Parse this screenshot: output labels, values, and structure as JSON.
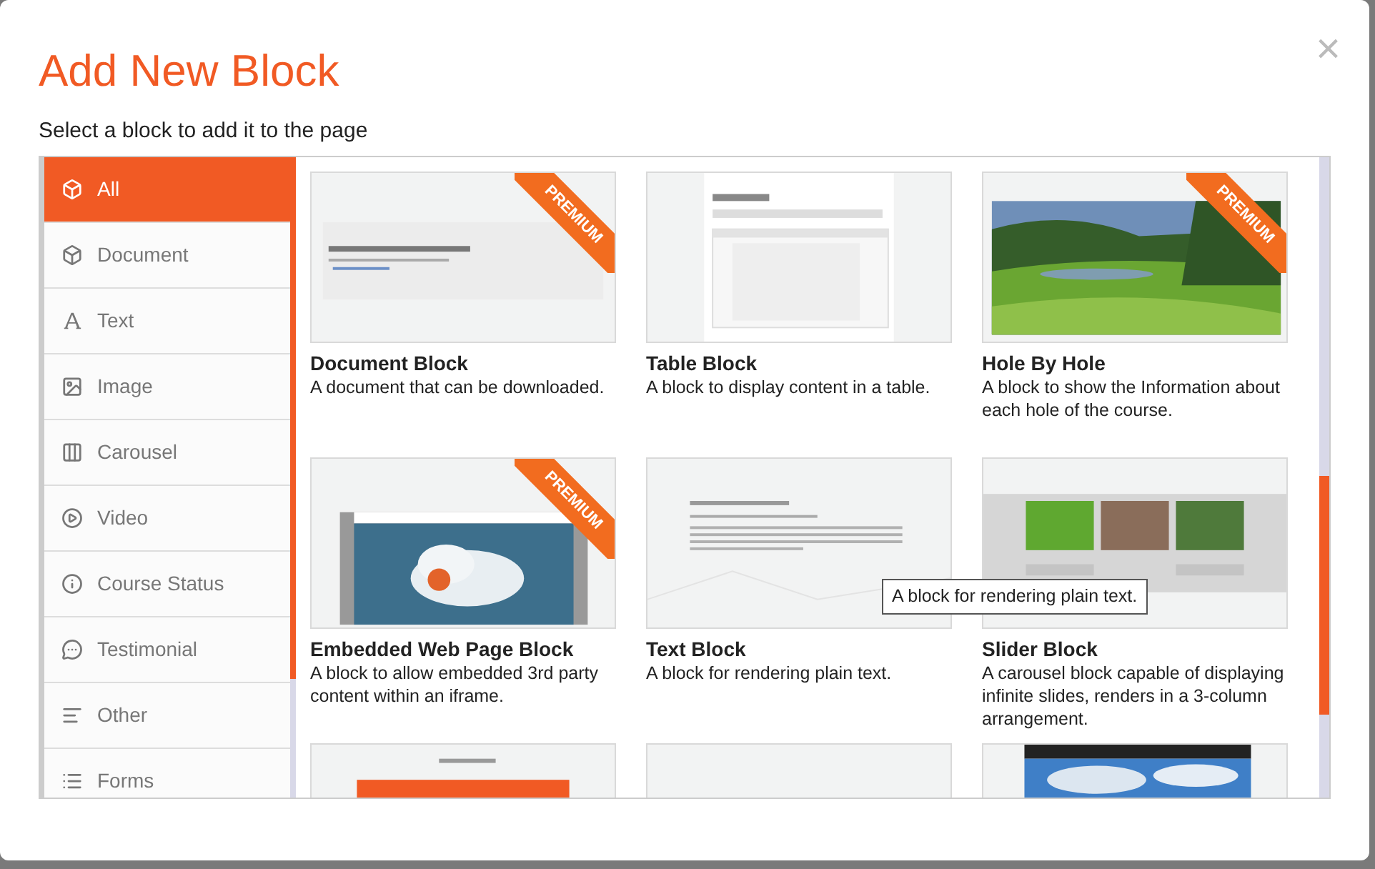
{
  "dialog": {
    "title": "Add New Block",
    "subtitle": "Select a block to add it to the page",
    "close": "×"
  },
  "sidebar": {
    "items": [
      {
        "label": "All",
        "selected": true
      },
      {
        "label": "Document",
        "selected": false
      },
      {
        "label": "Text",
        "selected": false
      },
      {
        "label": "Image",
        "selected": false
      },
      {
        "label": "Carousel",
        "selected": false
      },
      {
        "label": "Video",
        "selected": false
      },
      {
        "label": "Course Status",
        "selected": false
      },
      {
        "label": "Testimonial",
        "selected": false
      },
      {
        "label": "Other",
        "selected": false
      },
      {
        "label": "Forms",
        "selected": false
      }
    ]
  },
  "blocks": [
    {
      "kind": "block",
      "title": "Document Block",
      "description": "A document that can be downloaded.",
      "badge": "PREMIUM"
    },
    {
      "kind": "block",
      "title": "Table Block",
      "description": "A block to display content in a table."
    },
    {
      "kind": "block",
      "title": "Hole By Hole",
      "description": "A block to show the Information about each hole of the course.",
      "badge": "PREMIUM"
    },
    {
      "kind": "block",
      "title": "Embedded Web Page Block",
      "description": "A block to allow embedded 3rd party content within an iframe.",
      "badge": "PREMIUM"
    },
    {
      "kind": "block",
      "title": "Text Block",
      "description": "A block for rendering plain text."
    },
    {
      "kind": "block",
      "title": "Slider Block",
      "description": "A carousel block capable of displaying infinite slides, renders in a 3-column arrangement."
    },
    {
      "kind": "picture"
    },
    {
      "kind": "picture"
    },
    {
      "kind": "picture"
    }
  ],
  "tooltip": "A block for rendering plain text."
}
